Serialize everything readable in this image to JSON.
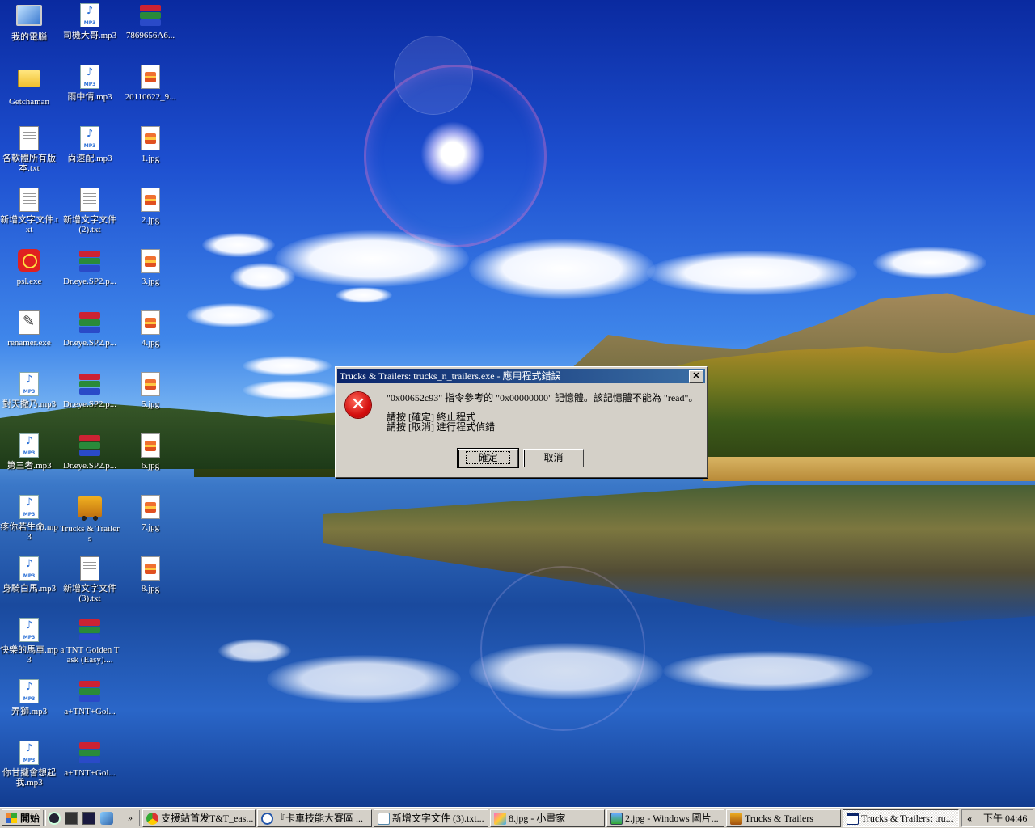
{
  "desktop": {
    "icons": [
      {
        "label": "我的電腦",
        "icon": "computer-icon"
      },
      {
        "label": "Getchaman",
        "icon": "folder-icon"
      },
      {
        "label": "各軟體所有版本.txt",
        "icon": "text-file-icon"
      },
      {
        "label": "新增文字文件.txt",
        "icon": "text-file-icon"
      },
      {
        "label": "psl.exe",
        "icon": "exe-icon"
      },
      {
        "label": "renamer.exe",
        "icon": "renamer-icon"
      },
      {
        "label": "對天撒乃.mp3",
        "icon": "mp3-file-icon"
      },
      {
        "label": "第三者.mp3",
        "icon": "mp3-file-icon"
      },
      {
        "label": "疼你若生命.mp3",
        "icon": "mp3-file-icon"
      },
      {
        "label": "身騎白馬.mp3",
        "icon": "mp3-file-icon"
      },
      {
        "label": "快樂的馬車.mp3",
        "icon": "mp3-file-icon"
      },
      {
        "label": "弄獅.mp3",
        "icon": "mp3-file-icon"
      },
      {
        "label": "你甘攏會想起我.mp3",
        "icon": "mp3-file-icon"
      },
      {
        "label": "司機大哥.mp3",
        "icon": "mp3-file-icon"
      },
      {
        "label": "雨中情.mp3",
        "icon": "mp3-file-icon"
      },
      {
        "label": "尚速配.mp3",
        "icon": "mp3-file-icon"
      },
      {
        "label": "新增文字文件 (2).txt",
        "icon": "text-file-icon"
      },
      {
        "label": "Dr.eye.SP2.p...",
        "icon": "rar-archive-icon"
      },
      {
        "label": "Dr.eye.SP2.p...",
        "icon": "rar-archive-icon"
      },
      {
        "label": "Dr.eye.SP2.p...",
        "icon": "rar-archive-icon"
      },
      {
        "label": "Dr.eye.SP2.p...",
        "icon": "rar-archive-icon"
      },
      {
        "label": "Trucks & Trailers",
        "icon": "truck-icon"
      },
      {
        "label": "新增文字文件 (3).txt",
        "icon": "text-file-icon"
      },
      {
        "label": "a TNT Golden Task (Easy)....",
        "icon": "rar-archive-icon"
      },
      {
        "label": "a+TNT+Gol...",
        "icon": "rar-archive-icon"
      },
      {
        "label": "a+TNT+Gol...",
        "icon": "rar-archive-icon"
      },
      {
        "label": "7869656A6...",
        "icon": "rar-archive-icon"
      },
      {
        "label": "20110622_9...",
        "icon": "jpg-file-icon"
      },
      {
        "label": "1.jpg",
        "icon": "jpg-file-icon"
      },
      {
        "label": "2.jpg",
        "icon": "jpg-file-icon"
      },
      {
        "label": "3.jpg",
        "icon": "jpg-file-icon"
      },
      {
        "label": "4.jpg",
        "icon": "jpg-file-icon"
      },
      {
        "label": "5.jpg",
        "icon": "jpg-file-icon"
      },
      {
        "label": "6.jpg",
        "icon": "jpg-file-icon"
      },
      {
        "label": "7.jpg",
        "icon": "jpg-file-icon"
      },
      {
        "label": "8.jpg",
        "icon": "jpg-file-icon"
      }
    ]
  },
  "dialog": {
    "title": "Trucks & Trailers: trucks_n_trailers.exe - 應用程式錯誤",
    "close_label": "✕",
    "message_line1": "\"0x00652c93\" 指令參考的 \"0x00000000\" 記憶體。該記憶體不能為 \"read\"。",
    "message_line2": "請按 [確定] 終止程式",
    "message_line3": "請按 [取消] 進行程式偵錯",
    "ok_label": "確定",
    "cancel_label": "取消"
  },
  "taskbar": {
    "start_label": "開始",
    "quick_launch_chevron": "»",
    "tasks": [
      {
        "label": "支援站首发T&T_eas...",
        "icon": "chrome-icon"
      },
      {
        "label": "『卡車技能大賽區 ...",
        "icon": "browser-icon"
      },
      {
        "label": "新增文字文件 (3).txt...",
        "icon": "notepad-icon"
      },
      {
        "label": "8.jpg - 小畫家",
        "icon": "paint-icon"
      },
      {
        "label": "2.jpg - Windows 圖片...",
        "icon": "image-viewer-icon"
      },
      {
        "label": "Trucks & Trailers",
        "icon": "truck-icon"
      },
      {
        "label": "Trucks & Trailers: tru...",
        "icon": "window-icon"
      }
    ],
    "tray_chevron": "«",
    "clock": "下午 04:46"
  },
  "colors": {
    "titlebar_start": "#0a246a",
    "titlebar_end": "#3a6ea5",
    "face": "#d4d0c8",
    "error_red": "#d40f0f"
  }
}
